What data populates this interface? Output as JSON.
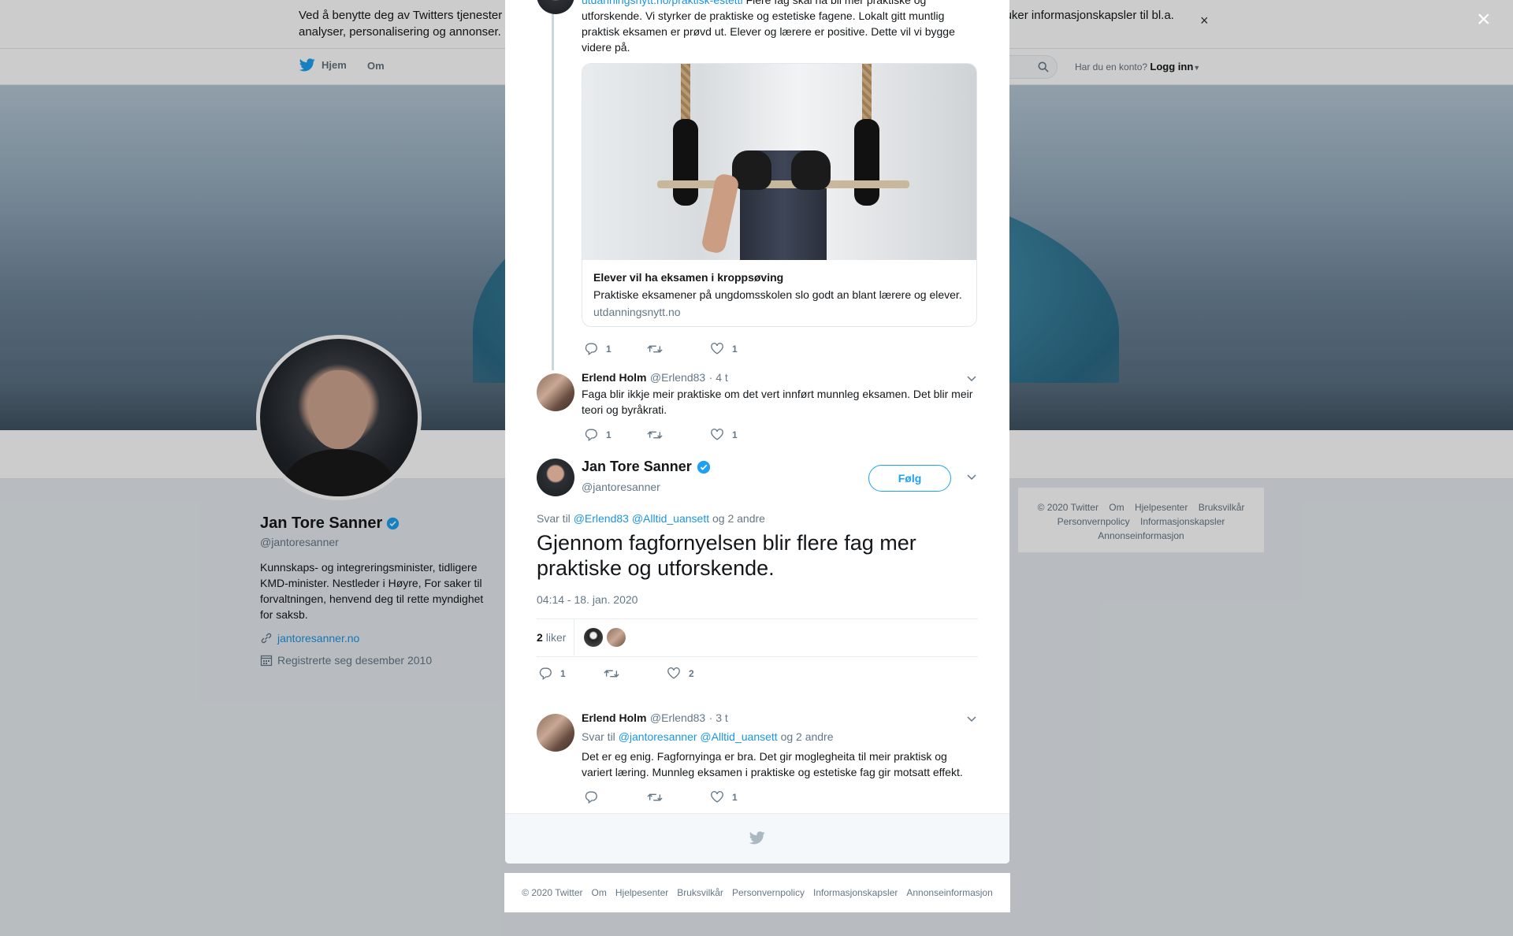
{
  "cookie_banner": {
    "text": "Ved å benytte deg av Twitters tjenester samtykker du i vår bruk av informasjonskapsler. Twitter og partnerne våre opererer globalt og bruker informasjonskapsler til bl.a. analyser, personalisering og annonser.",
    "close": "×"
  },
  "topnav": {
    "home": "Hjem",
    "about": "Om",
    "account_prompt": "Har du en konto?",
    "login": "Logg inn"
  },
  "profile": {
    "name": "Jan Tore Sanner",
    "handle": "@jantoresanner",
    "bio": "Kunnskaps- og integreringsminister, tidligere KMD-minister. Nestleder i Høyre, For saker til forvaltningen, henvend deg til rette myndighet for saksb.",
    "url": "jantoresanner.no",
    "joined": "Registrerte seg desember 2010"
  },
  "side_footer": {
    "links": [
      "© 2020 Twitter",
      "Om",
      "Hjelpesenter",
      "Bruksvilkår",
      "Personvernpolicy",
      "Informasjonskapsler",
      "Annonseinformasjon"
    ]
  },
  "overlay_close": "×",
  "thread": {
    "parent_tweet": {
      "text_link": "utdanningsnytt.no/praktisk-estetti",
      "text": "Flere fag skal ha bli mer praktiske og utforskende. Vi styrker de praktiske og estetiske fagene. Lokalt gitt muntlig praktisk eksamen er prøvd ut. Elever og lærere er positive. Dette vil vi bygge videre på.",
      "card": {
        "title": "Elever vil ha eksamen i kroppsøving",
        "description": "Praktiske eksamener på ungdomsskolen slo godt an blant lærere og elever.",
        "domain": "utdanningsnytt.no"
      },
      "replies": "1",
      "retweets": "",
      "likes": "1"
    },
    "reply1": {
      "name": "Erlend Holm",
      "handle": "@Erlend83",
      "time": "· 4 t",
      "text": "Faga blir ikkje meir praktiske om det vert innført munnleg eksamen. Det blir meir teori og byråkrati.",
      "replies": "1",
      "retweets": "",
      "likes": "1"
    },
    "main": {
      "name": "Jan Tore Sanner",
      "handle": "@jantoresanner",
      "follow": "Følg",
      "reply_to_prefix": "Svar til",
      "reply_to_users": "@Erlend83 @Alltid_uansett",
      "reply_to_suffix": "og 2 andre",
      "text": "Gjennom fagfornyelsen blir flere fag mer praktiske og utforskende.",
      "timestamp": "04:14 - 18. jan. 2020",
      "likes_count": "2",
      "likes_label": "liker",
      "replies": "1",
      "retweets": "",
      "likes": "2"
    },
    "reply2": {
      "name": "Erlend Holm",
      "handle": "@Erlend83",
      "time": "· 3 t",
      "reply_to_prefix": "Svar til",
      "reply_to_users": "@jantoresanner @Alltid_uansett",
      "reply_to_suffix": "og 2 andre",
      "text": "Det er eg enig. Fagfornyinga er bra. Det gir moglegheita til meir praktisk og variert læring. Munnleg eksamen i praktiske og estetiske fag gir motsatt effekt.",
      "replies": "",
      "retweets": "",
      "likes": "1"
    }
  },
  "bottom_footer": {
    "links": [
      "© 2020 Twitter",
      "Om",
      "Hjelpesenter",
      "Bruksvilkår",
      "Personvernpolicy",
      "Informasjonskapsler",
      "Annonseinformasjon"
    ]
  },
  "colors": {
    "accent": "#1da1f2",
    "link": "#1b95e0",
    "muted": "#657786"
  }
}
